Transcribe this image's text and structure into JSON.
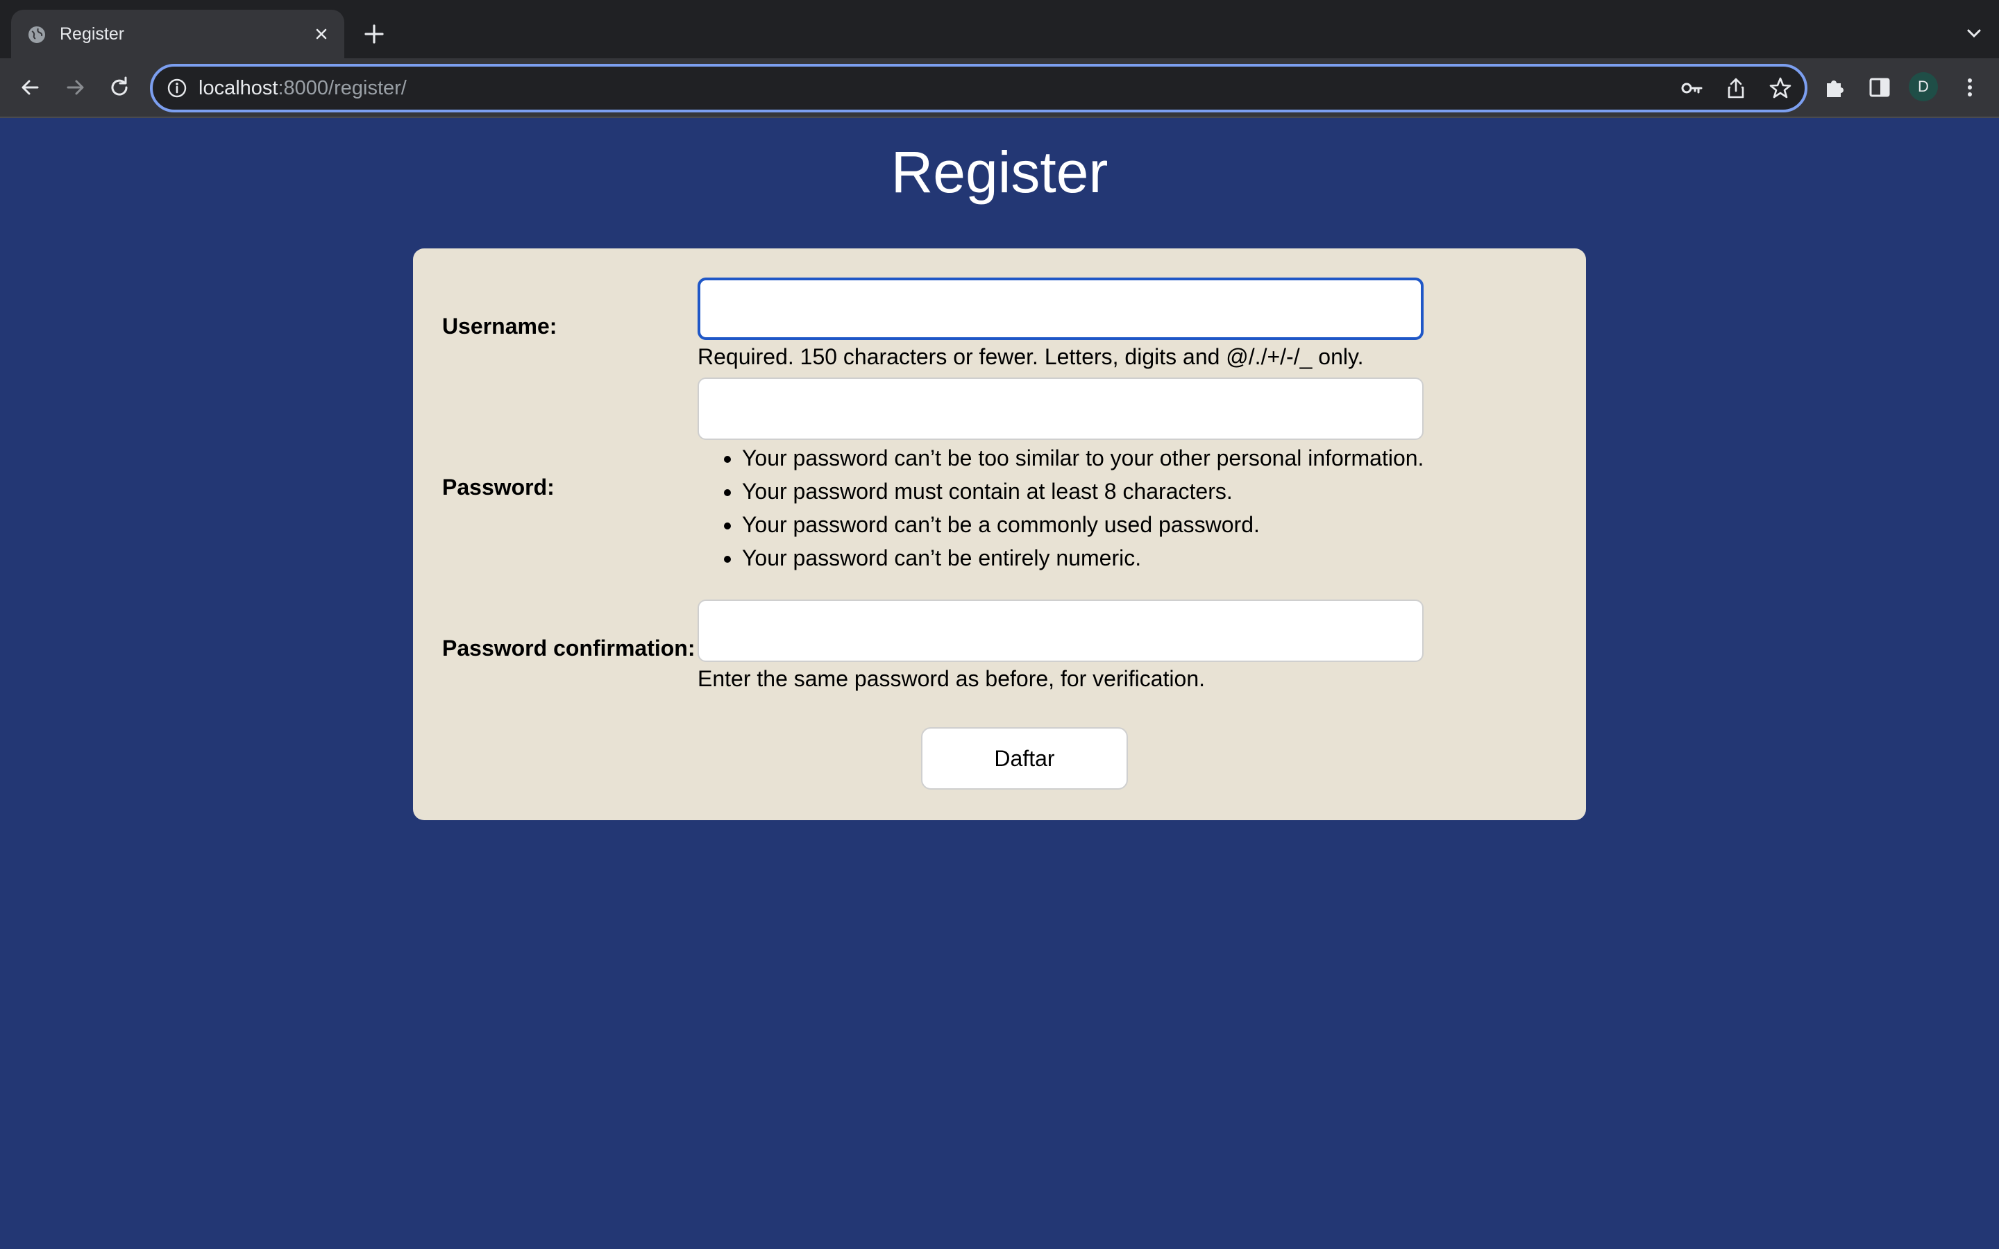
{
  "browser": {
    "tab": {
      "title": "Register"
    },
    "address_bar": {
      "host": "localhost",
      "path": ":8000/register/"
    },
    "profile_initial": "D"
  },
  "page": {
    "title": "Register",
    "form": {
      "username": {
        "label": "Username:",
        "value": "",
        "help": "Required. 150 characters or fewer. Letters, digits and @/./+/-/_ only."
      },
      "password": {
        "label": "Password:",
        "value": "",
        "rules": [
          "Your password can’t be too similar to your other personal information.",
          "Your password must contain at least 8 characters.",
          "Your password can’t be a commonly used password.",
          "Your password can’t be entirely numeric."
        ]
      },
      "password_confirmation": {
        "label": "Password confirmation:",
        "value": "",
        "help": "Enter the same password as before, for verification."
      },
      "submit_label": "Daftar"
    }
  },
  "colors": {
    "page_background": "#233774",
    "card_background": "#e8e2d4",
    "focus_ring": "#1f57c7"
  }
}
